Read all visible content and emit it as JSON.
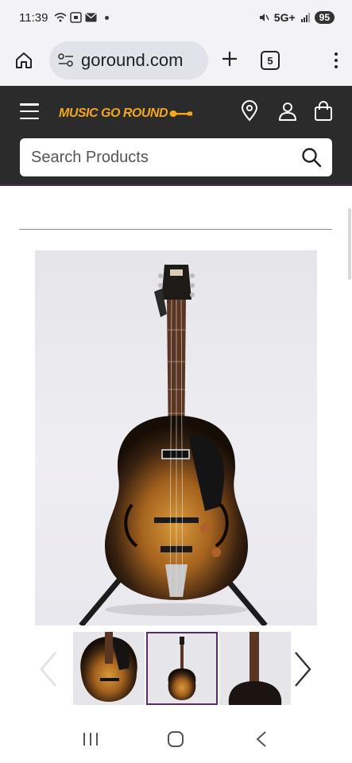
{
  "status_bar": {
    "time": "11:39",
    "network": "5G+",
    "battery": "95"
  },
  "browser": {
    "url": "goround.com",
    "tab_count": "5"
  },
  "site": {
    "logo_text": "MUSIC GO ROUND",
    "search": {
      "placeholder": "Search Products"
    },
    "accent_color": "#f2a71c",
    "header_color": "#2b2b2b"
  },
  "product": {
    "main_image": "hollow-body-archtop-guitar-sunburst",
    "thumbnails": [
      {
        "name": "guitar-body-closeup",
        "active": false
      },
      {
        "name": "guitar-full-view",
        "active": true
      },
      {
        "name": "guitar-back-view",
        "active": false
      }
    ]
  },
  "icons": {
    "home": "home-icon",
    "site_info": "site-settings-icon",
    "new_tab": "plus-icon",
    "menu": "more-vert-icon",
    "location": "location-pin-icon",
    "account": "user-icon",
    "cart": "shopping-bag-icon",
    "search": "search-icon"
  }
}
